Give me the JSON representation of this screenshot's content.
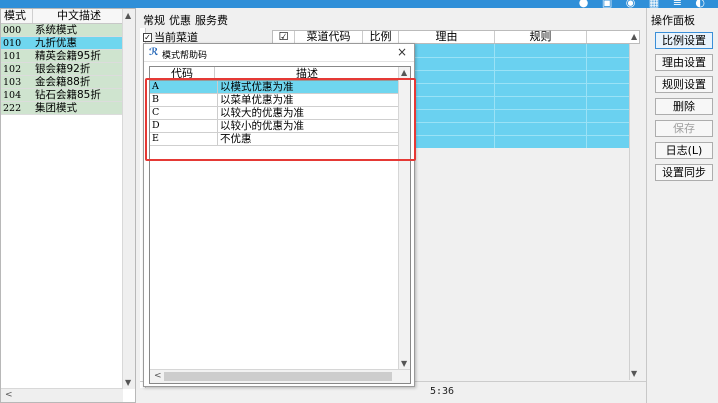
{
  "top_icons": "● ▣ ◉ ▦ ≡ ◐",
  "left_panel": {
    "headers": [
      "模式",
      "中文描述"
    ],
    "rows": [
      {
        "code": "000",
        "desc": "系统模式",
        "style": "tinted"
      },
      {
        "code": "010",
        "desc": "九折优惠",
        "style": "sel"
      },
      {
        "code": "101",
        "desc": "精英会籍95折",
        "style": "tinted"
      },
      {
        "code": "102",
        "desc": "银会籍92折",
        "style": "tinted"
      },
      {
        "code": "103",
        "desc": "金会籍88折",
        "style": "tinted"
      },
      {
        "code": "104",
        "desc": "钻石会籍85折",
        "style": "tinted"
      },
      {
        "code": "222",
        "desc": "集团模式",
        "style": "tinted"
      }
    ]
  },
  "center": {
    "tabs": [
      "常规",
      "优惠",
      "服务费"
    ],
    "current_dish_label": "当前菜道",
    "grid_headers": [
      "☑",
      "菜道代码",
      "比例",
      "理由",
      "规则"
    ],
    "status_time": "5:36"
  },
  "dialog": {
    "title": "模式帮助码",
    "close": "×",
    "headers": [
      "代码",
      "描述"
    ],
    "rows": [
      {
        "code": "A",
        "desc": "以模式优惠为准",
        "selected": true
      },
      {
        "code": "B",
        "desc": "以菜单优惠为准",
        "selected": false
      },
      {
        "code": "C",
        "desc": "以较大的优惠为准",
        "selected": false
      },
      {
        "code": "D",
        "desc": "以较小的优惠为准",
        "selected": false
      },
      {
        "code": "E",
        "desc": "不优惠",
        "selected": false
      }
    ]
  },
  "right_panel": {
    "title": "操作面板",
    "buttons": [
      {
        "label": "比例设置",
        "state": "primary"
      },
      {
        "label": "理由设置",
        "state": "normal"
      },
      {
        "label": "规则设置",
        "state": "normal"
      },
      {
        "label": "删除",
        "state": "normal"
      },
      {
        "label": "保存",
        "state": "disabled"
      },
      {
        "label": "日志(L)",
        "state": "normal"
      },
      {
        "label": "设置同步",
        "state": "normal"
      }
    ]
  },
  "colors": {
    "selection": "#6fd6ef",
    "grid_fill": "#6ad1f0",
    "highlight_box": "#e53935",
    "row_tint": "#cfe4cf"
  }
}
